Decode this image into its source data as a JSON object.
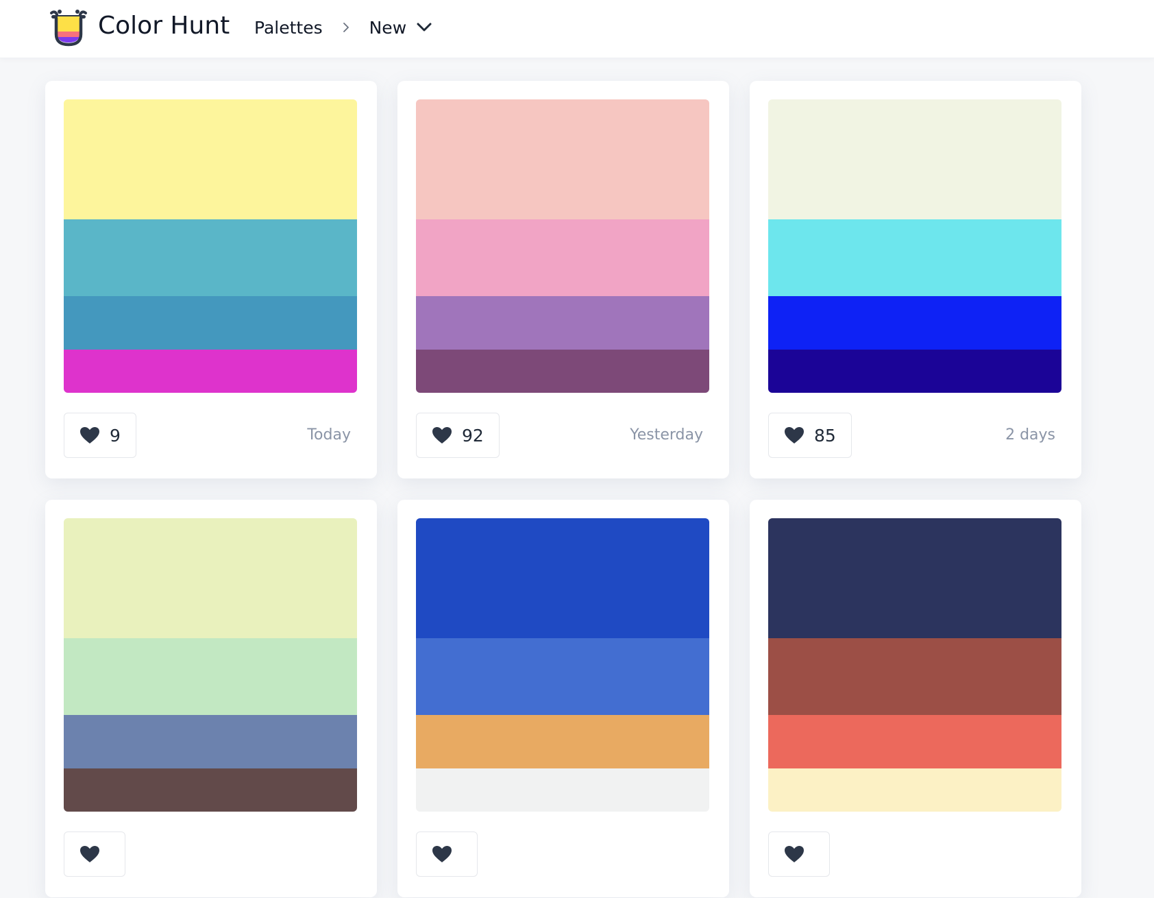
{
  "header": {
    "brand": "Color Hunt",
    "breadcrumb": {
      "first": "Palettes",
      "current": "New"
    },
    "icons": {
      "logo": "color-hunt-logo-icon",
      "separator": "chevron-right-icon",
      "dropdown": "chevron-down-icon"
    }
  },
  "palettes": [
    {
      "colors": [
        "#fdf59c",
        "#5ab6c8",
        "#4498be",
        "#de33cc"
      ],
      "likes": "9",
      "date": "Today"
    },
    {
      "colors": [
        "#f6c6c1",
        "#f1a4c5",
        "#a075bb",
        "#7d4978"
      ],
      "likes": "92",
      "date": "Yesterday"
    },
    {
      "colors": [
        "#f1f4e3",
        "#6de6ed",
        "#0e22f5",
        "#1b0497"
      ],
      "likes": "85",
      "date": "2 days"
    },
    {
      "colors": [
        "#e9f1bd",
        "#c2e8c2",
        "#6c82ae",
        "#624a4a"
      ],
      "likes": "",
      "date": ""
    },
    {
      "colors": [
        "#1f4ac3",
        "#436ed1",
        "#e8aa62",
        "#f1f2f2"
      ],
      "likes": "",
      "date": ""
    },
    {
      "colors": [
        "#2c345e",
        "#9c4f46",
        "#ec695c",
        "#fcf1c5"
      ],
      "likes": "",
      "date": ""
    }
  ],
  "theme": {
    "heart_color": "#2d3748",
    "date_color": "#8a94a6"
  }
}
